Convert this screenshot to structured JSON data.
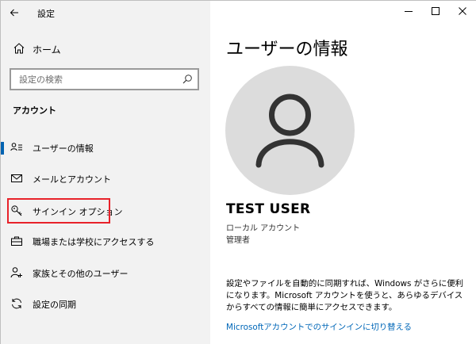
{
  "app": {
    "title": "設定"
  },
  "sidebar": {
    "home_label": "ホーム",
    "search_placeholder": "設定の検索",
    "section_header": "アカウント",
    "selected_index": 0,
    "items": [
      {
        "label": "ユーザーの情報",
        "icon": "user-info-icon"
      },
      {
        "label": "メールとアカウント",
        "icon": "mail-icon"
      },
      {
        "label": "サインイン オプション",
        "icon": "key-icon"
      },
      {
        "label": "職場または学校にアクセスする",
        "icon": "briefcase-icon"
      },
      {
        "label": "家族とその他のユーザー",
        "icon": "person-add-icon"
      },
      {
        "label": "設定の同期",
        "icon": "sync-icon"
      }
    ]
  },
  "main": {
    "page_title": "ユーザーの情報",
    "user_name": "TEST USER",
    "account_type": "ローカル アカウント",
    "role": "管理者",
    "description": "設定やファイルを自動的に同期すれば、Windows がさらに便利になります。Microsoft アカウントを使うと、あらゆるデバイスからすべての情報に簡単にアクセスできます。",
    "switch_link": "Microsoftアカウントでのサインインに切り替える"
  },
  "colors": {
    "accent": "#0063b1",
    "link": "#0067b8",
    "highlight_border": "#e8222a",
    "sidebar_bg": "#f2f2f2",
    "avatar_bg": "#dcdcdc",
    "avatar_glyph": "#333333"
  }
}
